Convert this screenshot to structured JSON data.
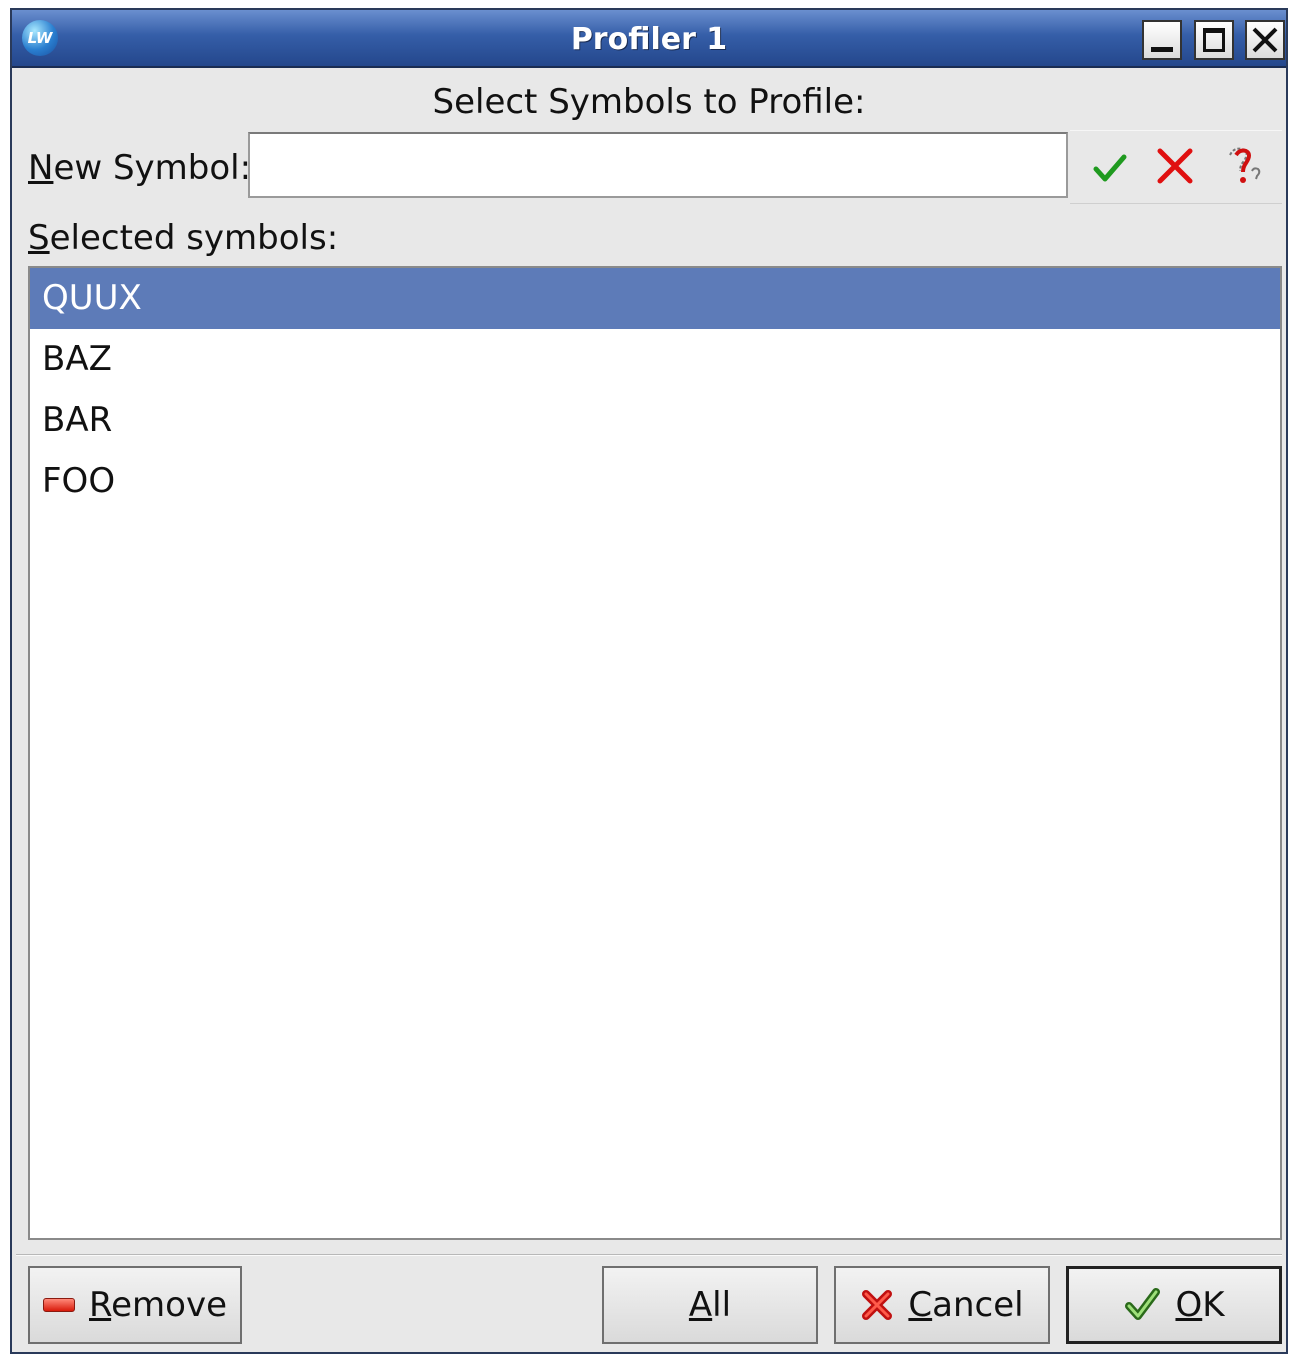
{
  "window": {
    "title": "Profiler 1",
    "app_icon_text": "LW"
  },
  "dialog": {
    "heading": "Select Symbols to Profile:",
    "new_symbol": {
      "label_mnemonic": "N",
      "label_rest": "ew Symbol:",
      "value": "",
      "placeholder": ""
    },
    "toolbar_icons": [
      "checkmark-icon",
      "cross-icon",
      "help-icon"
    ],
    "selected": {
      "label_mnemonic": "S",
      "label_rest": "elected symbols:",
      "items": [
        "QUUX",
        "BAZ",
        "BAR",
        "FOO"
      ],
      "selected_index": 0
    }
  },
  "buttons": {
    "remove": {
      "mnemonic": "R",
      "rest": "emove"
    },
    "all": {
      "mnemonic": "A",
      "rest": "ll"
    },
    "cancel": {
      "mnemonic": "C",
      "rest": "ancel"
    },
    "ok": {
      "mnemonic": "O",
      "rest": "K"
    }
  },
  "colors": {
    "title_bar": "#355ea8",
    "selection": "#5d7bb8",
    "dialog_bg": "#e8e8e8"
  }
}
